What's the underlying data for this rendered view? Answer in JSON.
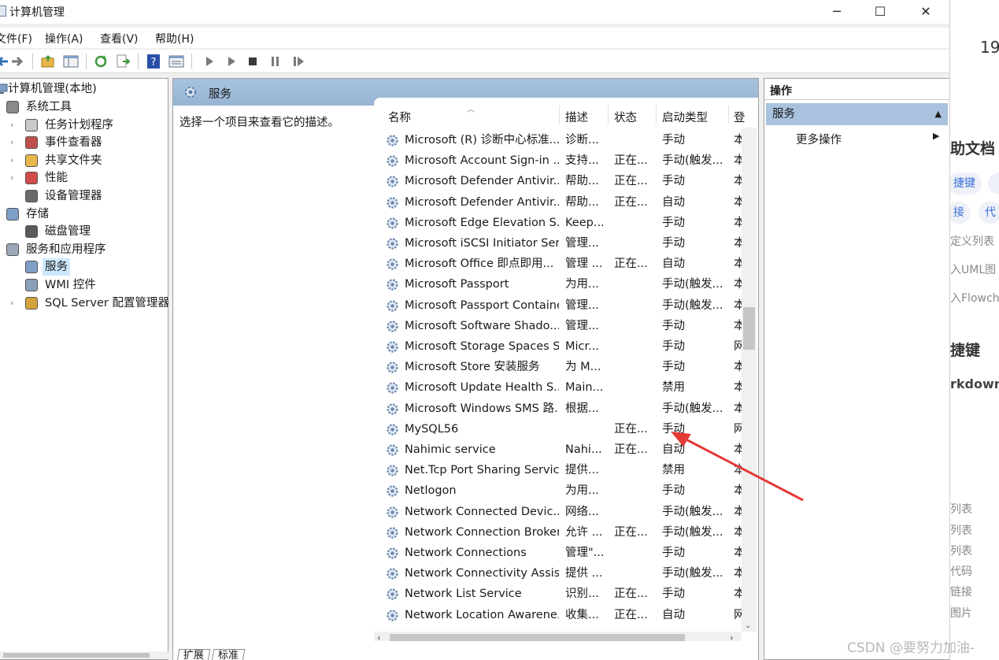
{
  "window": {
    "title": "计算机管理",
    "minimize_glyph": "─",
    "maximize_glyph": "☐",
    "close_glyph": "✕"
  },
  "menu": [
    "文件(F)",
    "操作(A)",
    "查看(V)",
    "帮助(H)"
  ],
  "toolbar": {
    "icons": [
      "back-icon",
      "forward-icon",
      "up-folder-icon",
      "show-hide-tree-icon",
      "refresh-icon",
      "export-list-icon",
      "help-icon",
      "properties-icon",
      "start-service-icon",
      "start-alt-icon",
      "stop-service-icon",
      "pause-service-icon",
      "restart-service-icon"
    ]
  },
  "tree": {
    "root": "计算机管理(本地)",
    "items": [
      {
        "label": "系统工具",
        "level": 1,
        "icon": "tools-icon",
        "expandable": false
      },
      {
        "label": "任务计划程序",
        "level": 2,
        "icon": "clock-icon",
        "expandable": true
      },
      {
        "label": "事件查看器",
        "level": 2,
        "icon": "event-viewer-icon",
        "expandable": true
      },
      {
        "label": "共享文件夹",
        "level": 2,
        "icon": "shared-folder-icon",
        "expandable": true
      },
      {
        "label": "性能",
        "level": 2,
        "icon": "performance-icon",
        "expandable": true
      },
      {
        "label": "设备管理器",
        "level": 2,
        "icon": "device-manager-icon",
        "expandable": false
      },
      {
        "label": "存储",
        "level": 1,
        "icon": "storage-icon",
        "expandable": false
      },
      {
        "label": "磁盘管理",
        "level": 2,
        "icon": "disk-icon",
        "expandable": false
      },
      {
        "label": "服务和应用程序",
        "level": 1,
        "icon": "services-apps-icon",
        "expandable": false
      },
      {
        "label": "服务",
        "level": 2,
        "icon": "gear-icon",
        "expandable": false,
        "selected": true
      },
      {
        "label": "WMI 控件",
        "level": 2,
        "icon": "wmi-icon",
        "expandable": false
      },
      {
        "label": "SQL Server 配置管理器",
        "level": 2,
        "icon": "sql-server-icon",
        "expandable": true
      }
    ]
  },
  "center": {
    "title": "服务",
    "description_prompt": "选择一个项目来查看它的描述。",
    "columns": [
      "名称",
      "描述",
      "状态",
      "启动类型",
      "登"
    ],
    "services": [
      {
        "name": "Microsoft (R) 诊断中心标准...",
        "desc": "诊断...",
        "status": "",
        "startup": "手动",
        "logon": "本"
      },
      {
        "name": "Microsoft Account Sign-in ...",
        "desc": "支持...",
        "status": "正在...",
        "startup": "手动(触发...",
        "logon": "本"
      },
      {
        "name": "Microsoft Defender Antivir...",
        "desc": "帮助...",
        "status": "正在...",
        "startup": "手动",
        "logon": "本"
      },
      {
        "name": "Microsoft Defender Antivir...",
        "desc": "帮助...",
        "status": "正在...",
        "startup": "自动",
        "logon": "本"
      },
      {
        "name": "Microsoft Edge Elevation S...",
        "desc": "Keep...",
        "status": "",
        "startup": "手动",
        "logon": "本"
      },
      {
        "name": "Microsoft iSCSI Initiator Ser...",
        "desc": "管理...",
        "status": "",
        "startup": "手动",
        "logon": "本"
      },
      {
        "name": "Microsoft Office 即点即用...",
        "desc": "管理 ...",
        "status": "正在...",
        "startup": "自动",
        "logon": "本"
      },
      {
        "name": "Microsoft Passport",
        "desc": "为用...",
        "status": "",
        "startup": "手动(触发...",
        "logon": "本"
      },
      {
        "name": "Microsoft Passport Container",
        "desc": "管理...",
        "status": "",
        "startup": "手动(触发...",
        "logon": "本"
      },
      {
        "name": "Microsoft Software Shado...",
        "desc": "管理...",
        "status": "",
        "startup": "手动",
        "logon": "本"
      },
      {
        "name": "Microsoft Storage Spaces S...",
        "desc": "Micr...",
        "status": "",
        "startup": "手动",
        "logon": "网"
      },
      {
        "name": "Microsoft Store 安装服务",
        "desc": "为 M...",
        "status": "",
        "startup": "手动",
        "logon": "本"
      },
      {
        "name": "Microsoft Update Health S...",
        "desc": "Main...",
        "status": "",
        "startup": "禁用",
        "logon": "本"
      },
      {
        "name": "Microsoft Windows SMS 路...",
        "desc": "根据...",
        "status": "",
        "startup": "手动(触发...",
        "logon": "本"
      },
      {
        "name": "MySQL56",
        "desc": "",
        "status": "正在...",
        "startup": "手动",
        "logon": "网"
      },
      {
        "name": "Nahimic service",
        "desc": "Nahi...",
        "status": "正在...",
        "startup": "自动",
        "logon": "本"
      },
      {
        "name": "Net.Tcp Port Sharing Service",
        "desc": "提供...",
        "status": "",
        "startup": "禁用",
        "logon": "本"
      },
      {
        "name": "Netlogon",
        "desc": "为用...",
        "status": "",
        "startup": "手动",
        "logon": "本"
      },
      {
        "name": "Network Connected Devic...",
        "desc": "网络...",
        "status": "",
        "startup": "手动(触发...",
        "logon": "本"
      },
      {
        "name": "Network Connection Broker",
        "desc": "允许 ...",
        "status": "正在...",
        "startup": "手动(触发...",
        "logon": "本"
      },
      {
        "name": "Network Connections",
        "desc": "管理\"...",
        "status": "",
        "startup": "手动",
        "logon": "本"
      },
      {
        "name": "Network Connectivity Assis...",
        "desc": "提供 ...",
        "status": "",
        "startup": "手动(触发...",
        "logon": "本"
      },
      {
        "name": "Network List Service",
        "desc": "识别...",
        "status": "正在...",
        "startup": "手动",
        "logon": "本"
      },
      {
        "name": "Network Location Awarene...",
        "desc": "收集...",
        "status": "正在...",
        "startup": "自动",
        "logon": "网"
      }
    ],
    "tabs": [
      "扩展",
      "标准"
    ]
  },
  "actions": {
    "header": "操作",
    "section": "服务",
    "more": "更多操作"
  },
  "background_page": {
    "top_number": "19",
    "heading": "助文档",
    "pills": [
      "捷键",
      "接",
      "代"
    ],
    "lines": [
      "定义列表",
      "入UML图",
      "入Flowch"
    ],
    "heading2": "捷键",
    "subheading": "rkdown",
    "list": [
      "列表",
      "列表",
      "列表",
      "代码",
      "链接",
      "图片"
    ]
  },
  "watermark": "CSDN @要努力加油-",
  "colors": {
    "header_blue": "#a7c2dd",
    "selection": "#cce8ff",
    "annotation_arrow": "#e53935"
  }
}
